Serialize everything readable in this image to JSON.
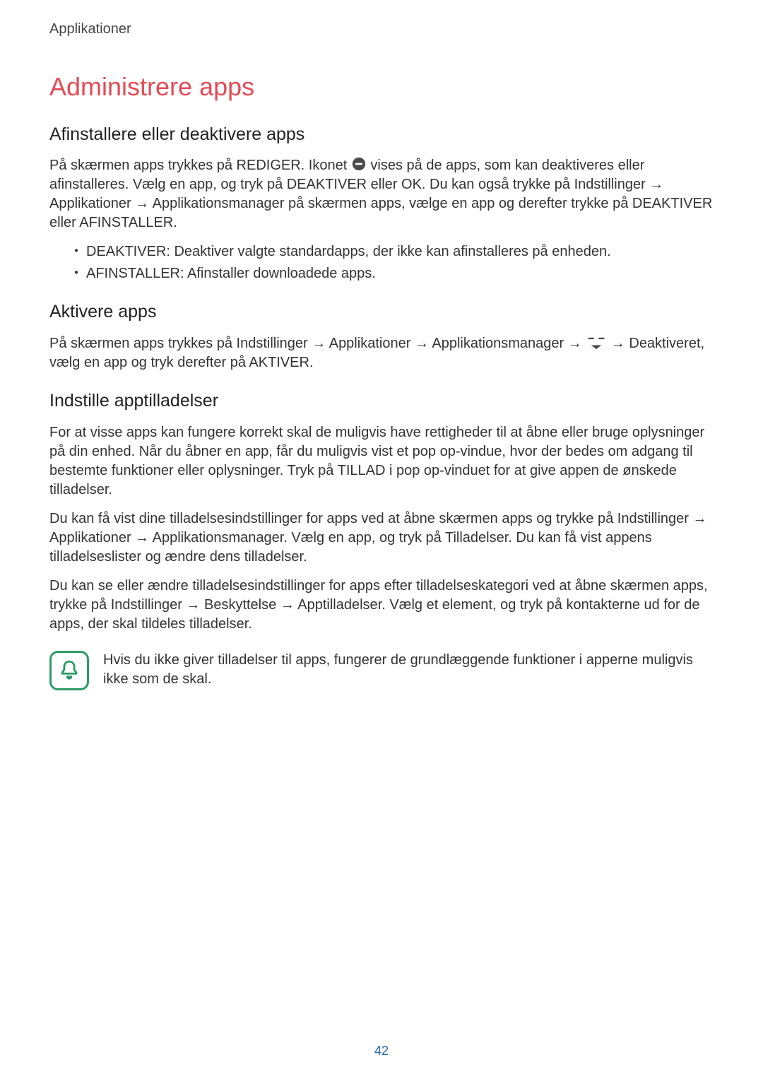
{
  "breadcrumb": "Applikationer",
  "heading": "Administrere apps",
  "section1": {
    "title": "Afinstallere eller deaktivere apps",
    "p1a": "På skærmen apps trykkes på REDIGER. Ikonet ",
    "p1b": " vises på de apps, som kan deaktiveres eller afinstalleres. Vælg en app, og tryk på DEAKTIVER eller OK. Du kan også trykke på Indstillinger → Applikationer → Applikationsmanager på skærmen apps, vælge en app og derefter trykke på DEAKTIVER eller AFINSTALLER.",
    "b1": "DEAKTIVER: Deaktiver valgte standardapps, der ikke kan afinstalleres på enheden.",
    "b2": "AFINSTALLER: Afinstaller downloadede apps."
  },
  "section2": {
    "title": "Aktivere apps",
    "p1a": "På skærmen apps trykkes på Indstillinger → Applikationer → Applikationsmanager → ",
    "p1b": " → Deaktiveret, vælg en app og tryk derefter på AKTIVER."
  },
  "section3": {
    "title": "Indstille apptilladelser",
    "p1": "For at visse apps kan fungere korrekt skal de muligvis have rettigheder til at åbne eller bruge oplysninger på din enhed. Når du åbner en app, får du muligvis vist et pop op-vindue, hvor der bedes om adgang til bestemte funktioner eller oplysninger. Tryk på TILLAD i pop op-vinduet for at give appen de ønskede tilladelser.",
    "p2": "Du kan få vist dine tilladelsesindstillinger for apps ved at åbne skærmen apps og trykke på Indstillinger → Applikationer → Applikationsmanager. Vælg en app, og tryk på Tilladelser. Du kan få vist appens tilladelseslister og ændre dens tilladelser.",
    "p3": "Du kan se eller ændre tilladelsesindstillinger for apps efter tilladelseskategori ved at åbne skærmen apps, trykke på Indstillinger → Beskyttelse → Apptilladelser. Vælg et element, og tryk på kontakterne ud for de apps, der skal tildeles tilladelser."
  },
  "note": "Hvis du ikke giver tilladelser til apps, fungerer de grundlæggende funktioner i apperne muligvis ikke som de skal.",
  "pagenum": "42"
}
